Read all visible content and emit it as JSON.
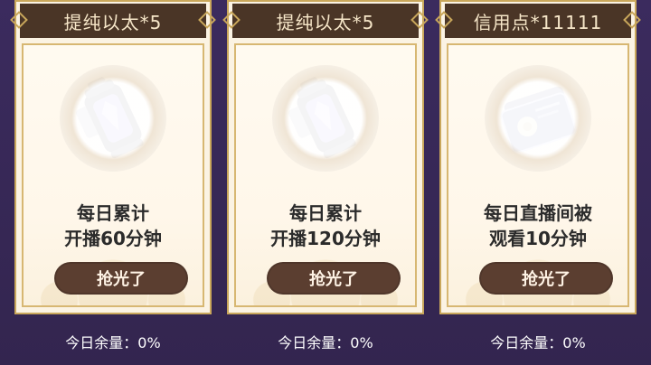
{
  "cards": [
    {
      "header": "提纯以太*5",
      "title_line1": "每日累计",
      "title_line2": "开播60分钟",
      "button": "抢光了",
      "remaining": "今日余量：0%",
      "icon": "ether-canister-icon"
    },
    {
      "header": "提纯以太*5",
      "title_line1": "每日累计",
      "title_line2": "开播120分钟",
      "button": "抢光了",
      "remaining": "今日余量：0%",
      "icon": "ether-canister-icon"
    },
    {
      "header": "信用点*11111",
      "title_line1": "每日直播间被",
      "title_line2": "观看10分钟",
      "button": "抢光了",
      "remaining": "今日余量：0%",
      "icon": "credit-card-icon"
    }
  ],
  "colors": {
    "background": "#3a2a5c",
    "card": "#fbf3e3",
    "gold": "#c9a75b",
    "header": "#4a3526",
    "button": "#5b3e30"
  }
}
